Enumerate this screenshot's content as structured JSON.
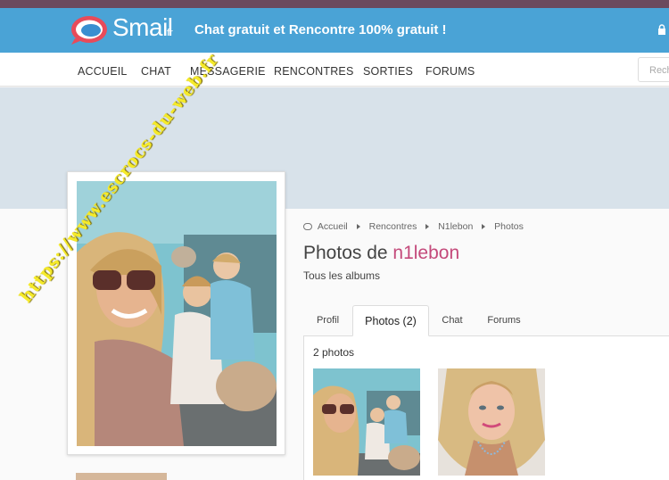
{
  "header": {
    "logo_text": "Smail",
    "logo_tld": ".fr",
    "tagline": "Chat gratuit et Rencontre 100% gratuit !"
  },
  "nav": {
    "items": [
      "ACCUEIL",
      "CHAT",
      "MESSAGERIE",
      "RENCONTRES",
      "SORTIES",
      "FORUMS"
    ],
    "search_placeholder": "Rech"
  },
  "breadcrumb": [
    "Accueil",
    "Rencontres",
    "N1lebon",
    "Photos"
  ],
  "page": {
    "title_prefix": "Photos de ",
    "username": "n1lebon",
    "subtitle": "Tous les albums"
  },
  "tabs": [
    "Profil",
    "Photos (2)",
    "Chat",
    "Forums"
  ],
  "album": {
    "count_label": "2 photos"
  },
  "watermark": "https://www.escrocs-du-web.fr",
  "colors": {
    "header_bg": "#4aa3d6",
    "accent_username": "#c44a7b",
    "watermark": "#f5ea2a"
  }
}
